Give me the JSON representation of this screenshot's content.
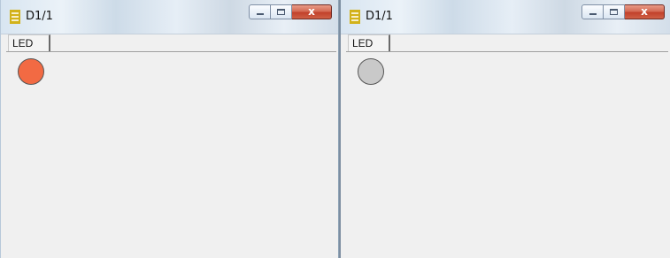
{
  "windows": [
    {
      "title": "D1/1",
      "tab_label": "LED",
      "led_color": "#f26a43",
      "led_state": "on",
      "close_glyph": "x"
    },
    {
      "title": "D1/1",
      "tab_label": "LED",
      "led_color": "#c9c9c9",
      "led_state": "off",
      "close_glyph": "x"
    }
  ],
  "icons": {
    "app": "app-icon",
    "minimize": "minimize-icon",
    "maximize": "maximize-icon",
    "close": "close-icon"
  },
  "colors": {
    "led_on": "#f26a43",
    "led_off": "#c9c9c9",
    "close_button": "#c9442f",
    "app_icon": "#d2b21a"
  }
}
